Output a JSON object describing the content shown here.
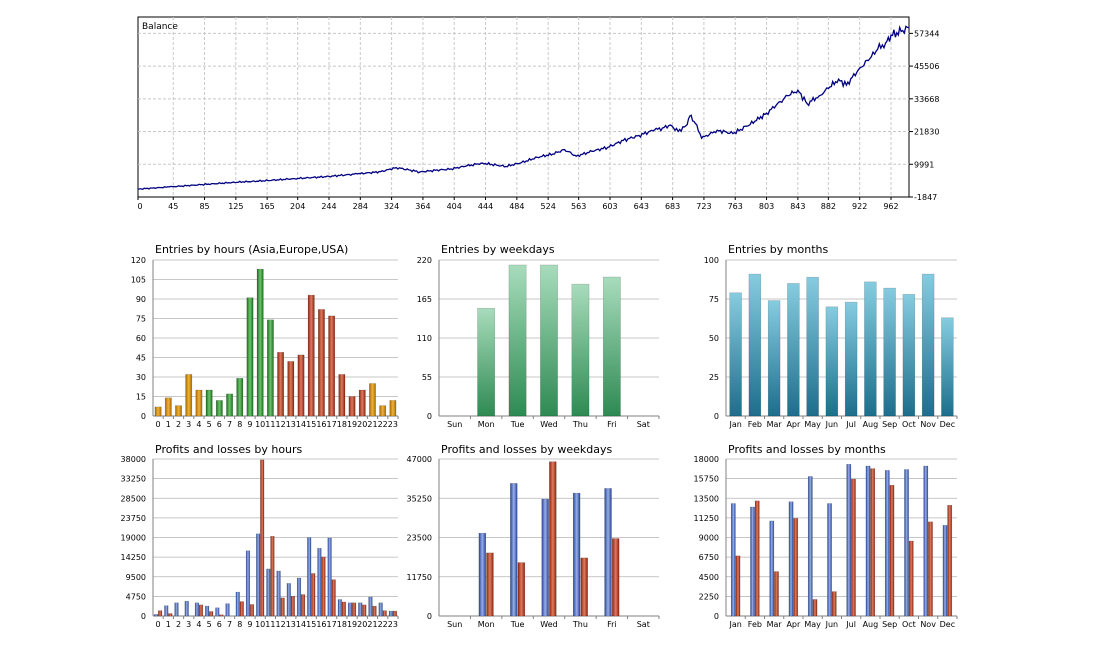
{
  "chart_data": [
    {
      "id": "balance",
      "type": "line",
      "title": "Balance",
      "x_ticks": [
        "0",
        "45",
        "85",
        "125",
        "165",
        "204",
        "244",
        "284",
        "324",
        "364",
        "404",
        "444",
        "484",
        "524",
        "563",
        "603",
        "643",
        "683",
        "723",
        "763",
        "803",
        "843",
        "882",
        "922",
        "962"
      ],
      "y_ticks": [
        "57344",
        "45506",
        "33668",
        "21830",
        "9991",
        "-1847"
      ],
      "xlim": [
        0,
        985
      ],
      "ylim": [
        -1847,
        63263
      ],
      "grid": true,
      "color": "#000080",
      "series": [
        {
          "x": [
            0,
            40,
            80,
            120,
            160,
            200,
            240,
            280,
            310,
            330,
            360,
            380,
            400,
            420,
            440,
            470,
            490,
            510,
            530,
            545,
            560,
            580,
            600,
            620,
            640,
            660,
            670,
            680,
            690,
            700,
            705,
            712,
            720,
            740,
            760,
            770,
            790,
            803,
            815,
            830,
            843,
            855,
            870,
            882,
            895,
            905,
            922,
            935,
            945,
            955,
            962,
            975,
            985
          ],
          "y": [
            1000,
            1800,
            2600,
            3400,
            4000,
            4800,
            5500,
            6500,
            7300,
            8800,
            7200,
            7800,
            8300,
            9400,
            10400,
            9200,
            10600,
            12500,
            13700,
            15300,
            12900,
            14700,
            16100,
            18600,
            20400,
            22400,
            23100,
            24200,
            21900,
            23900,
            27400,
            24800,
            19400,
            22300,
            21100,
            22600,
            25800,
            28500,
            31200,
            34800,
            36800,
            31900,
            34700,
            37400,
            40800,
            38600,
            44800,
            48200,
            51600,
            53800,
            56700,
            58000,
            59400
          ]
        }
      ]
    },
    {
      "id": "entries-by-hours",
      "type": "bar",
      "title": "Entries by hours (Asia,Europe,USA)",
      "categories": [
        "0",
        "1",
        "2",
        "3",
        "4",
        "5",
        "6",
        "7",
        "8",
        "9",
        "10",
        "11",
        "12",
        "13",
        "14",
        "15",
        "16",
        "17",
        "18",
        "19",
        "20",
        "21",
        "22",
        "23"
      ],
      "values": [
        7,
        14,
        8,
        32,
        20,
        20,
        12,
        17,
        29,
        91,
        113,
        74,
        49,
        42,
        47,
        93,
        82,
        77,
        32,
        15,
        20,
        25,
        8,
        12
      ],
      "colors": [
        "#c8860a",
        "#c8860a",
        "#c8860a",
        "#c8860a",
        "#c8860a",
        "#2f8f2f",
        "#2f8f2f",
        "#2f8f2f",
        "#2f8f2f",
        "#2f8f2f",
        "#2f8f2f",
        "#2f8f2f",
        "#b03a22",
        "#b03a22",
        "#b03a22",
        "#b03a22",
        "#b03a22",
        "#b03a22",
        "#b03a22",
        "#b03a22",
        "#b03a22",
        "#c8860a",
        "#c8860a",
        "#c8860a"
      ],
      "y_ticks": [
        "120",
        "105",
        "90",
        "75",
        "60",
        "45",
        "30",
        "15",
        "0"
      ],
      "ylim": [
        0,
        120
      ]
    },
    {
      "id": "entries-by-weekdays",
      "type": "bar",
      "title": "Entries by weekdays",
      "categories": [
        "Sun",
        "Mon",
        "Tue",
        "Wed",
        "Thu",
        "Fri",
        "Sat"
      ],
      "values": [
        0,
        152,
        213,
        213,
        186,
        196,
        0
      ],
      "color": "#3a9a5c",
      "y_ticks": [
        "220",
        "165",
        "110",
        "55",
        "0"
      ],
      "ylim": [
        0,
        220
      ]
    },
    {
      "id": "entries-by-months",
      "type": "bar",
      "title": "Entries by months",
      "categories": [
        "Jan",
        "Feb",
        "Mar",
        "Apr",
        "May",
        "Jun",
        "Jul",
        "Aug",
        "Sep",
        "Oct",
        "Nov",
        "Dec"
      ],
      "values": [
        79,
        91,
        74,
        85,
        89,
        70,
        73,
        86,
        82,
        78,
        91,
        63
      ],
      "color": "#2a8ca8",
      "y_ticks": [
        "100",
        "75",
        "50",
        "25",
        "0"
      ],
      "ylim": [
        0,
        100
      ]
    },
    {
      "id": "profits-losses-by-hours",
      "type": "bar",
      "title": "Profits and losses by hours",
      "categories": [
        "0",
        "1",
        "2",
        "3",
        "4",
        "5",
        "6",
        "7",
        "8",
        "9",
        "10",
        "11",
        "12",
        "13",
        "14",
        "15",
        "16",
        "17",
        "18",
        "19",
        "20",
        "21",
        "22",
        "23"
      ],
      "series": [
        {
          "color": "#3a5fb0",
          "values": [
            400,
            2500,
            3200,
            3600,
            3200,
            2400,
            2000,
            3000,
            5800,
            15800,
            19900,
            11400,
            10900,
            7900,
            9200,
            19000,
            16400,
            18900,
            4000,
            3200,
            3200,
            4600,
            3200,
            1200
          ]
        },
        {
          "color": "#b03a22",
          "values": [
            1300,
            600,
            0,
            0,
            2700,
            1100,
            300,
            0,
            3500,
            2800,
            37800,
            19300,
            4400,
            4800,
            5200,
            10300,
            14300,
            8800,
            3400,
            3200,
            2700,
            2400,
            1300,
            1200
          ]
        }
      ],
      "y_ticks": [
        "38000",
        "33250",
        "28500",
        "23750",
        "19000",
        "14250",
        "9500",
        "4750",
        "0"
      ],
      "ylim": [
        0,
        38000
      ]
    },
    {
      "id": "profits-losses-by-weekdays",
      "type": "bar",
      "title": "Profits and losses by weekdays",
      "categories": [
        "Sun",
        "Mon",
        "Tue",
        "Wed",
        "Thu",
        "Fri",
        "Sat"
      ],
      "series": [
        {
          "color": "#3a5fb0",
          "values": [
            0,
            24800,
            39700,
            35000,
            36800,
            38200,
            0
          ]
        },
        {
          "color": "#b03a22",
          "values": [
            0,
            18900,
            16000,
            46200,
            17400,
            23200,
            0
          ]
        }
      ],
      "y_ticks": [
        "47000",
        "35250",
        "23500",
        "11750",
        "0"
      ],
      "ylim": [
        0,
        47000
      ]
    },
    {
      "id": "profits-losses-by-months",
      "type": "bar",
      "title": "Profits and losses by months",
      "categories": [
        "Jan",
        "Feb",
        "Mar",
        "Apr",
        "May",
        "Jun",
        "Jul",
        "Aug",
        "Sep",
        "Oct",
        "Nov",
        "Dec"
      ],
      "series": [
        {
          "color": "#3a5fb0",
          "values": [
            12900,
            12500,
            10900,
            13100,
            16000,
            12900,
            17400,
            17200,
            16700,
            16800,
            17200,
            10400
          ]
        },
        {
          "color": "#b03a22",
          "values": [
            6900,
            13200,
            5100,
            11200,
            1900,
            2800,
            15700,
            16900,
            15000,
            8600,
            10800,
            12700
          ]
        }
      ],
      "y_ticks": [
        "18000",
        "15750",
        "13500",
        "11250",
        "9000",
        "6750",
        "4500",
        "2250",
        "0"
      ],
      "ylim": [
        0,
        18000
      ]
    }
  ]
}
